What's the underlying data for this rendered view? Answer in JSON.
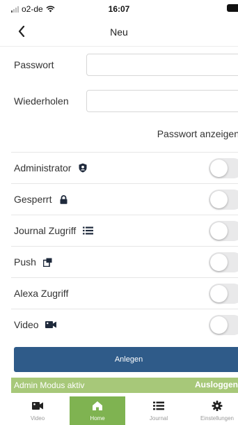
{
  "status_bar": {
    "carrier": "o2-de",
    "time": "16:07"
  },
  "nav": {
    "title": "Neu"
  },
  "form": {
    "password_label": "Passwort",
    "password_value": "",
    "repeat_label": "Wiederholen",
    "repeat_value": "",
    "show_password": "Passwort anzeigen"
  },
  "options": [
    {
      "label": "Administrator",
      "icon": "shield-user-icon",
      "enabled": false
    },
    {
      "label": "Gesperrt",
      "icon": "lock-icon",
      "enabled": false
    },
    {
      "label": "Journal Zugriff",
      "icon": "list-icon",
      "enabled": false
    },
    {
      "label": "Push",
      "icon": "push-notification-icon",
      "enabled": false
    },
    {
      "label": "Alexa Zugriff",
      "icon": "",
      "enabled": false
    },
    {
      "label": "Video",
      "icon": "video-camera-icon",
      "enabled": false
    }
  ],
  "create_button": "Anlegen",
  "admin_bar": {
    "text": "Admin Modus aktiv",
    "logout": "Ausloggen"
  },
  "tabs": [
    {
      "label": "Video",
      "icon": "video-camera-icon",
      "active": false
    },
    {
      "label": "Home",
      "icon": "home-icon",
      "active": true
    },
    {
      "label": "Journal",
      "icon": "list-icon",
      "active": false
    },
    {
      "label": "Einstellungen",
      "icon": "gear-icon",
      "active": false
    }
  ],
  "colors": {
    "primary_button": "#2f5b89",
    "admin_bar": "#a7c879",
    "active_tab": "#7fb351",
    "toggle_off": "#e9e9ea"
  }
}
